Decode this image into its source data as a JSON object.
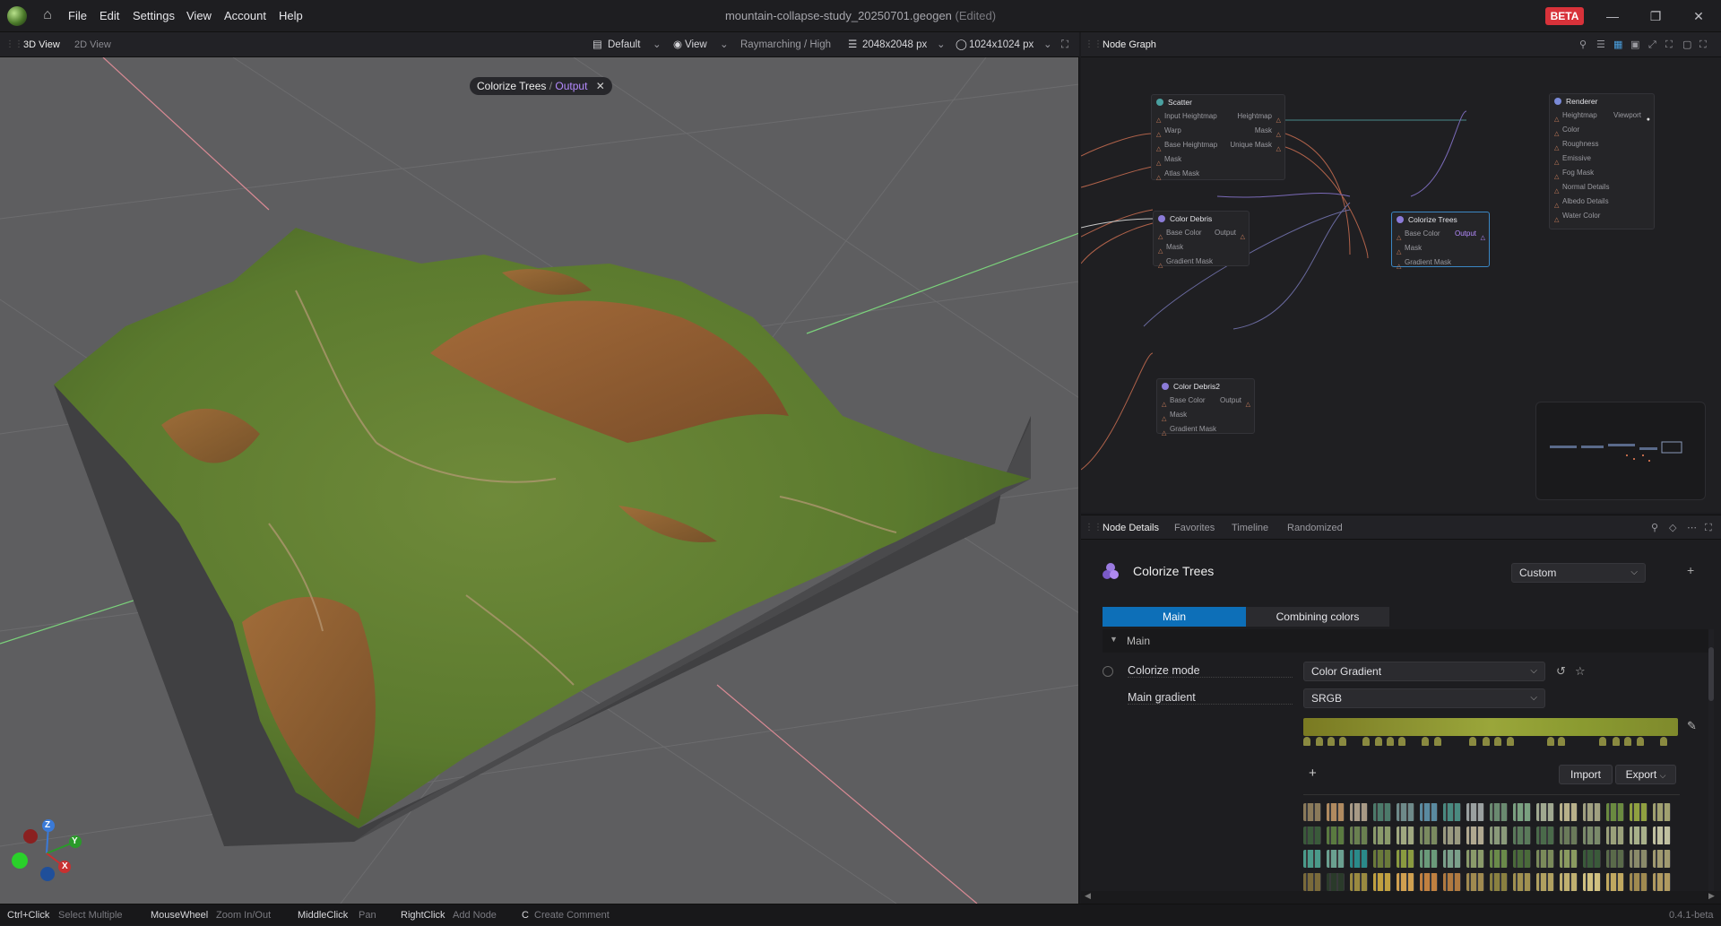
{
  "titlebar": {
    "menu": [
      "File",
      "Edit",
      "Settings",
      "View",
      "Account",
      "Help"
    ],
    "file_name": "mountain-collapse-study_20250701.geogen",
    "edited": "(Edited)",
    "beta": "BETA"
  },
  "viewport_toolbar": {
    "tabs": [
      "3D View",
      "2D View"
    ],
    "layout": "Default",
    "view": "View",
    "render_mode": "Raymarching / High",
    "resolution": "2048x2048 px",
    "output_res": "1024x1024 px"
  },
  "viewport": {
    "chip_title": "Colorize Trees",
    "chip_sep": " / ",
    "chip_sub": "Output",
    "axis": {
      "z": "Z",
      "y": "Y",
      "x": "X"
    }
  },
  "node_graph": {
    "title": "Node Graph",
    "nodes": {
      "scatter": {
        "title": "Scatter",
        "inputs": [
          "Input Heightmap",
          "Warp",
          "Base Heightmap",
          "Mask",
          "Atlas Mask"
        ],
        "outputs": [
          "Heightmap",
          "Mask",
          "Unique Mask"
        ]
      },
      "color_debris": {
        "title": "Color Debris",
        "inputs": [
          "Base Color",
          "Mask",
          "Gradient Mask"
        ],
        "outputs": [
          "Output"
        ]
      },
      "colorize_trees": {
        "title": "Colorize Trees",
        "inputs": [
          "Base Color",
          "Mask",
          "Gradient Mask"
        ],
        "outputs": [
          "Output"
        ]
      },
      "color_debris2": {
        "title": "Color Debris2",
        "inputs": [
          "Base Color",
          "Mask",
          "Gradient Mask"
        ],
        "outputs": [
          "Output"
        ]
      },
      "renderer": {
        "title": "Renderer",
        "inputs": [
          "Heightmap",
          "Color",
          "Roughness",
          "Emissive",
          "Fog Mask",
          "Normal Details",
          "Albedo Details",
          "Water Color"
        ],
        "outputs": [
          "Viewport"
        ]
      }
    }
  },
  "node_details": {
    "tabs": [
      "Node Details",
      "Favorites",
      "Timeline",
      "Randomized"
    ],
    "node_name": "Colorize Trees",
    "preset": "Custom",
    "subtabs": [
      "Main",
      "Combining colors"
    ],
    "section": "Main",
    "colorize_mode_label": "Colorize mode",
    "colorize_mode_value": "Color Gradient",
    "main_gradient_label": "Main gradient",
    "main_gradient_value": "SRGB",
    "import": "Import",
    "export": "Export",
    "gradient_colors": [
      "#7a7a22",
      "#8a9030",
      "#9aa63a",
      "#8a9a30",
      "#7f8a2c"
    ],
    "swatches": [
      [
        "#8a7a5a",
        "#b08a60",
        "#a89a86",
        "#4c7a6a",
        "#6e8a8a",
        "#5a8aa0",
        "#4a8a80",
        "#9aa0a0",
        "#6a8a70",
        "#7aa080",
        "#a0a890",
        "#b8b08a",
        "#a0a080",
        "#6a8a40",
        "#90a040",
        "#a0a070"
      ],
      [
        "#3a5a3a",
        "#5a7a40",
        "#6a8050",
        "#8a9a6a",
        "#a0a880",
        "#7a8a60",
        "#9a9a80",
        "#b0a890",
        "#8a9a7a",
        "#5a7a5a",
        "#4a6a4a",
        "#6a7a5a",
        "#7a8a6a",
        "#9aa07a",
        "#a8b08a",
        "#c0c0a0"
      ],
      [
        "#4a9a8a",
        "#6aa090",
        "#2a8a8a",
        "#6a7a3a",
        "#8a9a40",
        "#6a9a7a",
        "#7aa08a",
        "#8a9a6a",
        "#6a8a4a",
        "#4a6a3a",
        "#7a8a5a",
        "#8a9a60",
        "#3a5a3a",
        "#5a6a4a",
        "#8a8a6a",
        "#a09a70"
      ],
      [
        "#7a6a3a",
        "#2a3a2a",
        "#9a8a40",
        "#c0a040",
        "#d0a050",
        "#c08040",
        "#b07a40",
        "#a08a50",
        "#8a8040",
        "#a09050",
        "#b0a060",
        "#c0b070",
        "#d0c080",
        "#c0a860",
        "#a08a50",
        "#b09a60"
      ]
    ]
  },
  "statusbar": {
    "items": [
      {
        "key": "Ctrl+Click",
        "desc": "Select Multiple"
      },
      {
        "key": "MouseWheel",
        "desc": "Zoom In/Out"
      },
      {
        "key": "MiddleClick",
        "desc": "Pan"
      },
      {
        "key": "RightClick",
        "desc": "Add Node"
      },
      {
        "key": "C",
        "desc": "Create Comment"
      }
    ],
    "version": "0.4.1-beta"
  },
  "colors": {
    "accent": "#0d6fb8",
    "purple": "#b58bff",
    "beta": "#d8323a"
  }
}
